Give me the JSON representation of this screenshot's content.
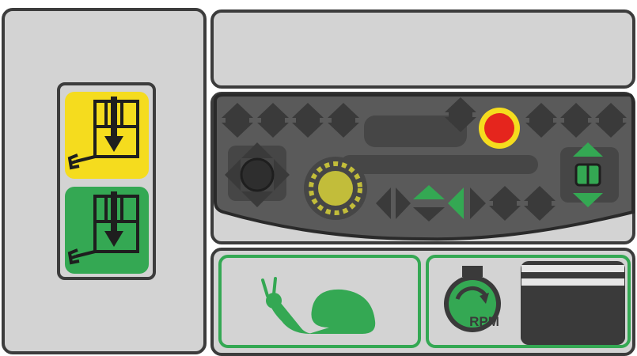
{
  "controls": {
    "rpm_label": "RPM",
    "rpm_level": 0.33,
    "colors": {
      "panel": "#d3d3d3",
      "border": "#3c3c3c",
      "console": "#5a5a5a",
      "button": "#3a3a3a",
      "yellow": "#f5dc1e",
      "green": "#34a853",
      "red": "#e5251d",
      "rpm_segment_on": "#e6e6e6"
    },
    "icons": [
      "bucket-lower-icon",
      "snail-icon",
      "rpm-gauge-icon",
      "emergency-stop-icon",
      "joystick-icon",
      "rotary-dial-icon"
    ]
  }
}
